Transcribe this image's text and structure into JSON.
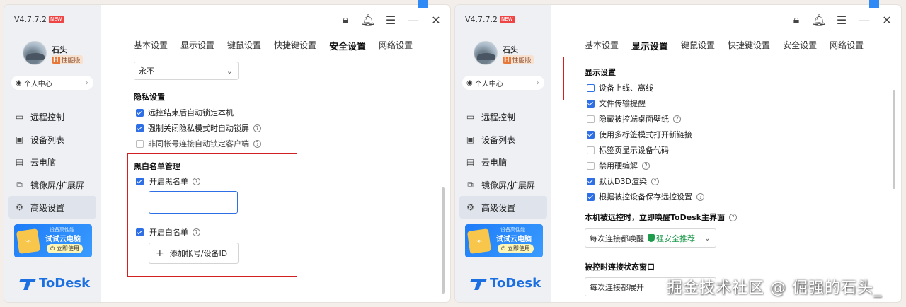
{
  "watermark": "掘金技术社区 @ 倔强的石头_",
  "left": {
    "version": "V4.7.7.2",
    "new_badge": "NEW",
    "user": {
      "name": "石头",
      "badge_h": "H",
      "badge_text": "性能版"
    },
    "personal_center": "个人中心",
    "nav": [
      "远程控制",
      "设备列表",
      "云电脑",
      "镜像屏/扩展屏",
      "高级设置"
    ],
    "nav_active": 4,
    "promo": {
      "line1": "设备高性能",
      "line2": "试试云电脑",
      "button": "立即使用"
    },
    "logo": "ToDesk",
    "tabs": [
      "基本设置",
      "显示设置",
      "键鼠设置",
      "快捷键设置",
      "安全设置",
      "网络设置"
    ],
    "active_tab": 4,
    "lock_select": "永不",
    "privacy": {
      "title": "隐私设置",
      "items": [
        {
          "label": "远控结束后自动锁定本机",
          "checked": true
        },
        {
          "label": "强制关闭隐私模式时自动锁屏",
          "checked": true
        },
        {
          "label": "非同帐号连接自动锁定客户端",
          "checked": false
        }
      ]
    },
    "bw": {
      "title": "黑白名单管理",
      "blacklist": "开启黑名单",
      "whitelist": "开启白名单",
      "add_button": "添加帐号/设备ID"
    }
  },
  "right": {
    "version": "V4.7.7.2",
    "new_badge": "NEW",
    "user": {
      "name": "石头",
      "badge_h": "H",
      "badge_text": "性能版"
    },
    "personal_center": "个人中心",
    "nav": [
      "远程控制",
      "设备列表",
      "云电脑",
      "镜像屏/扩展屏",
      "高级设置"
    ],
    "nav_active": 4,
    "promo": {
      "line1": "设备高性能",
      "line2": "试试云电脑",
      "button": "立即使用"
    },
    "logo": "ToDesk",
    "tabs": [
      "基本设置",
      "显示设置",
      "键鼠设置",
      "快捷键设置",
      "安全设置",
      "网络设置"
    ],
    "active_tab": 1,
    "display": {
      "title": "显示设置",
      "items": [
        {
          "label": "设备上线、离线",
          "checked": false,
          "help": false
        },
        {
          "label": "文件传输提醒",
          "checked": true,
          "help": false
        },
        {
          "label": "隐藏被控端桌面壁纸",
          "checked": false,
          "help": true
        },
        {
          "label": "使用多标签模式打开新链接",
          "checked": true,
          "help": false
        },
        {
          "label": "标签页显示设备代码",
          "checked": false,
          "help": false
        },
        {
          "label": "禁用硬编解",
          "checked": false,
          "help": true
        },
        {
          "label": "默认D3D渲染",
          "checked": true,
          "help": true
        },
        {
          "label": "根据被控设备保存远控设置",
          "checked": true,
          "help": true
        }
      ]
    },
    "wake": {
      "title": "本机被远控时，立即唤醒ToDesk主界面",
      "value": "每次连接都唤醒",
      "recommend": "强安全推荐"
    },
    "status_window": {
      "title": "被控时连接状态窗口",
      "value": "每次连接都展开"
    }
  }
}
